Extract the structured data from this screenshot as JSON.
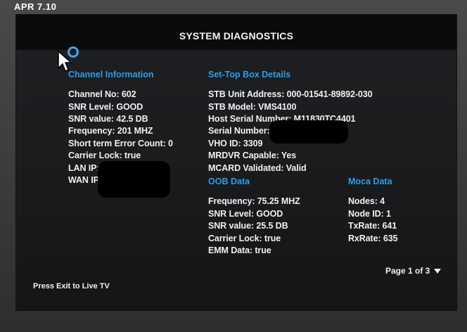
{
  "top_label": "APR 7.10",
  "title": "SYSTEM DIAGNOSTICS",
  "channel_info": {
    "heading": "Channel Information",
    "lines": [
      "Channel No: 602",
      "SNR Level: GOOD",
      "SNR value: 42.5 DB",
      "Frequency: 201 MHZ",
      "Short term Error Count: 0",
      "Carrier Lock: true",
      "LAN IP:",
      "WAN IP:"
    ]
  },
  "stb_details": {
    "heading": "Set-Top Box Details",
    "lines": [
      "STB Unit Address: 000-01541-89892-030",
      "STB Model: VMS4100",
      "Host Serial Number: M11830TC4401",
      "Serial Number:",
      "VHO ID: 3309",
      "MRDVR Capable: Yes",
      "MCARD Validated: Valid"
    ]
  },
  "oob_data": {
    "heading": "OOB Data",
    "lines": [
      "Frequency: 75.25 MHZ",
      "SNR Level: GOOD",
      "SNR value: 25.5 DB",
      "Carrier Lock: true",
      "EMM Data: true"
    ]
  },
  "moca_data": {
    "heading": "Moca Data",
    "lines": [
      "Nodes: 4",
      "Node ID: 1",
      "TxRate: 641",
      "RxRate: 635"
    ]
  },
  "page_indicator": "Page 1 of 3",
  "exit_hint": "Press Exit to Live TV",
  "colors": {
    "accent": "#2a9ee8",
    "text": "#f0f0f0",
    "background": "#1c1d1f",
    "title_bar": "#0b0b0b"
  }
}
